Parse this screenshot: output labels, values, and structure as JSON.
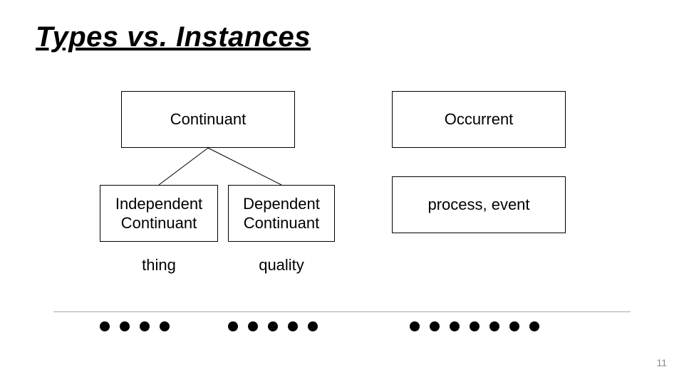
{
  "title": "Types vs. Instances",
  "boxes": {
    "continuant": "Continuant",
    "occurrent": "Occurrent",
    "independent_continuant": "Independent\nContinuant",
    "dependent_continuant": "Dependent\nContinuant",
    "process_event": "process, event"
  },
  "labels": {
    "thing": "thing",
    "quality": "quality"
  },
  "dot_groups": [
    4,
    5,
    7
  ],
  "page_number": "11"
}
